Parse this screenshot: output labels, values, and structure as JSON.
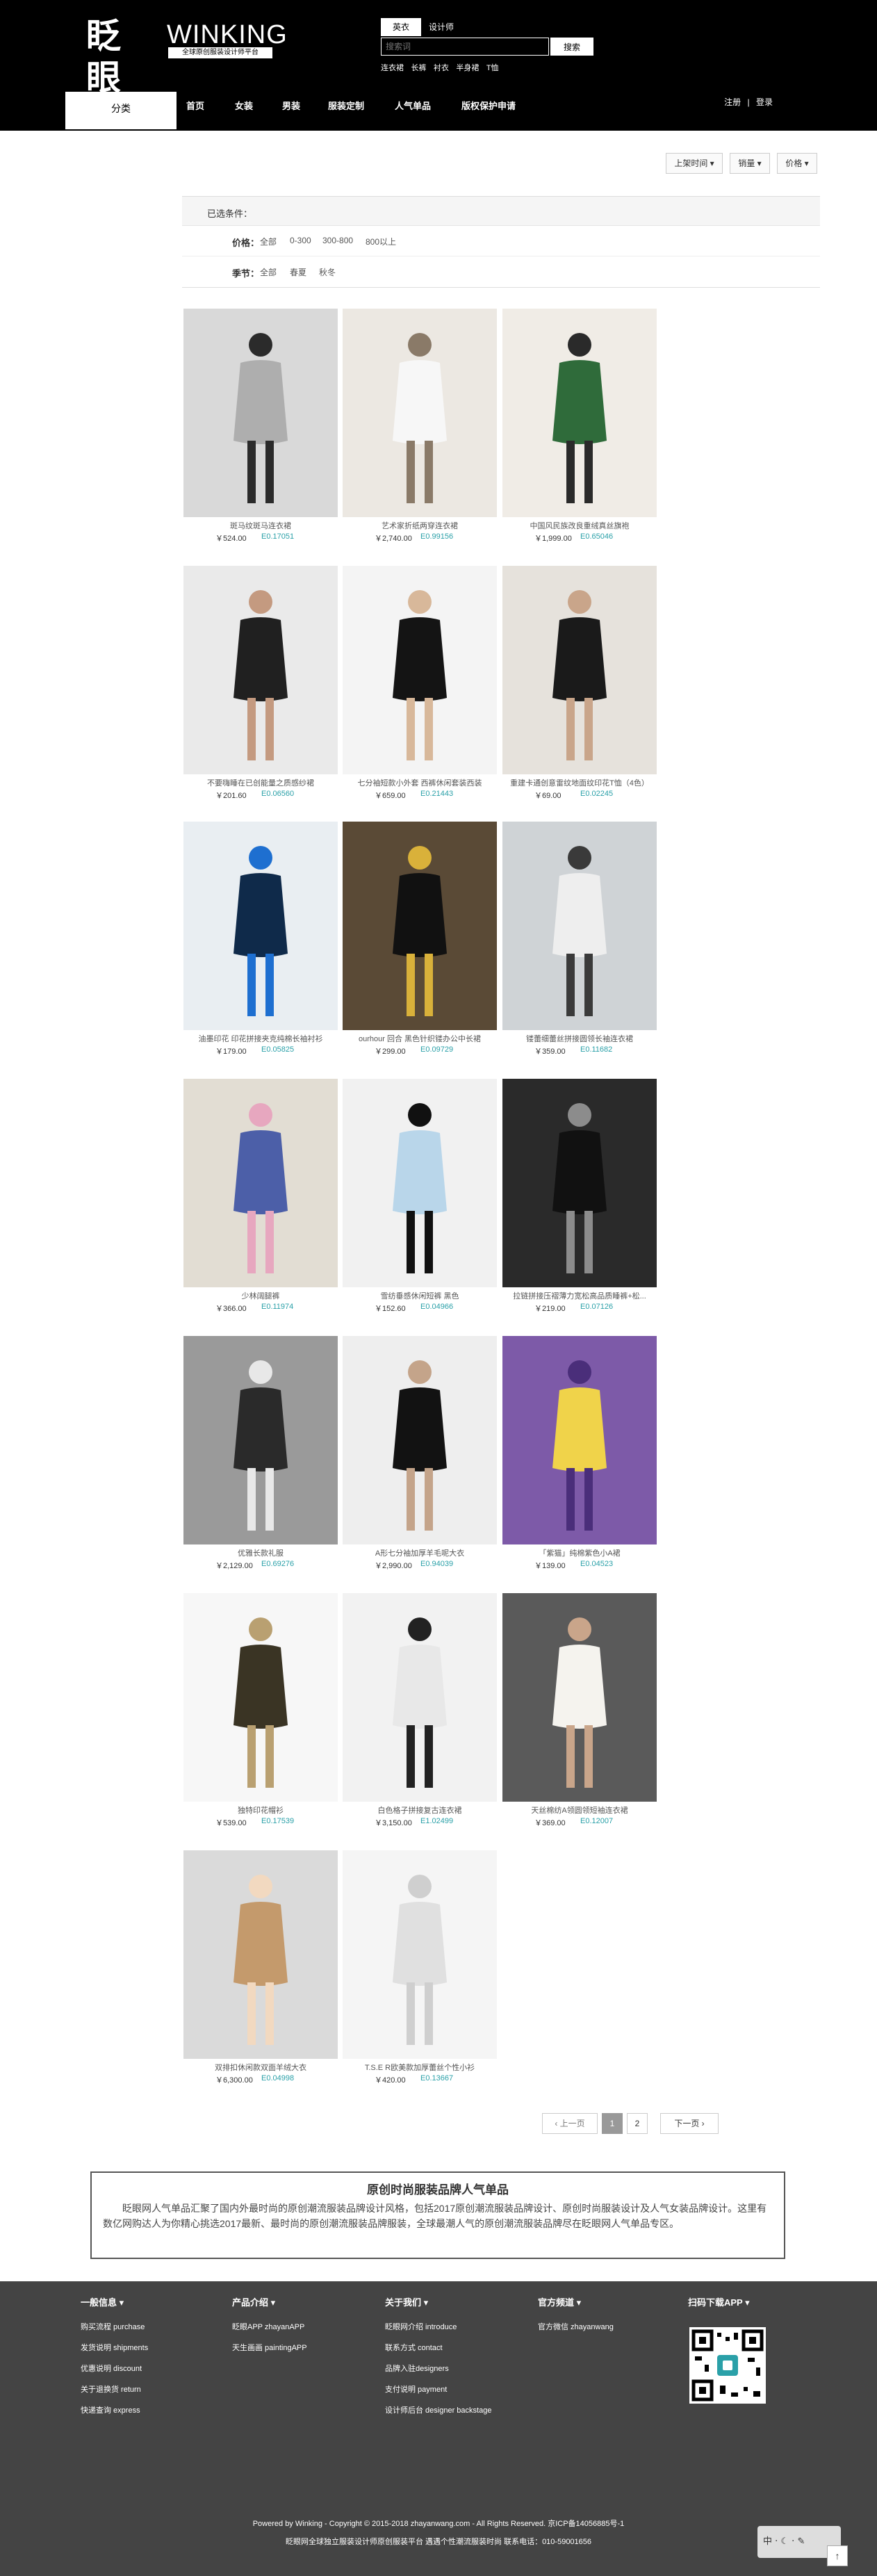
{
  "header": {
    "logo_cn": "眨眼",
    "logo_en": "WINKING",
    "logo_sub": "全球原创服装设计师平台",
    "search_tabs": [
      "英衣",
      "设计师"
    ],
    "search_placeholder": "搜索词",
    "search_button": "搜索",
    "hot_words": [
      "连衣裙",
      "长裤",
      "衬衣",
      "半身裙",
      "T恤"
    ],
    "nav_category": "分类",
    "nav_items": [
      "首页",
      "女装",
      "男装",
      "服装定制",
      "人气单品",
      "版权保护申请"
    ],
    "login": "注册",
    "divider": "|",
    "register": "登录"
  },
  "sort": [
    "上架时间 ▾",
    "销量 ▾",
    "价格 ▾"
  ],
  "filter": {
    "head": "已选条件：",
    "price_label": "价格：",
    "price_options": [
      "全部",
      "0-300",
      "300-800",
      "800以上"
    ],
    "season_label": "季节：",
    "season_options": [
      "全部",
      "春夏",
      "秋冬"
    ]
  },
  "products": [
    {
      "name": "斑马纹斑马连衣裙",
      "price": "￥524.00",
      "exch": "E0.17051"
    },
    {
      "name": "艺术家折纸两穿连衣裙",
      "price": "￥2,740.00",
      "exch": "E0.99156"
    },
    {
      "name": "中国风民族改良重绒真丝旗袍",
      "price": "￥1,999.00",
      "exch": "E0.65046"
    },
    {
      "name": "不要嗨睡在已创能量之质感纱裙",
      "price": "￥201.60",
      "exch": "E0.06560"
    },
    {
      "name": "七分袖短款小外套 西裤休闲套装西装",
      "price": "￥659.00",
      "exch": "E0.21443"
    },
    {
      "name": "重建卡通创意雷纹地面纹印花T恤（4色）",
      "price": "￥69.00",
      "exch": "E0.02245"
    },
    {
      "name": "油墨印花 印花拼接夹克纯棉长袖衬衫",
      "price": "￥179.00",
      "exch": "E0.05825"
    },
    {
      "name": "ourhour 回合 黑色针织镂办公中长裙",
      "price": "￥299.00",
      "exch": "E0.09729"
    },
    {
      "name": "镂蕾细蕾丝拼接圆领长袖连衣裙",
      "price": "￥359.00",
      "exch": "E0.11682"
    },
    {
      "name": "少林阔腿裤",
      "price": "￥366.00",
      "exch": "E0.11974"
    },
    {
      "name": "雪纺垂感休闲短裤 黑色",
      "price": "￥152.60",
      "exch": "E0.04966"
    },
    {
      "name": "拉链拼接压褶薄力宽松高品质睡裤+松...",
      "price": "￥219.00",
      "exch": "E0.07126"
    },
    {
      "name": "优雅长款礼服",
      "price": "￥2,129.00",
      "exch": "E0.69276"
    },
    {
      "name": "A形七分袖加厚羊毛呢大衣",
      "price": "￥2,990.00",
      "exch": "E0.94039"
    },
    {
      "name": "「紫猫」纯棉紫色小A裙",
      "price": "￥139.00",
      "exch": "E0.04523"
    },
    {
      "name": "独特印花帽衫",
      "price": "￥539.00",
      "exch": "E0.17539"
    },
    {
      "name": "白色格子拼接复古连衣裙",
      "price": "￥3,150.00",
      "exch": "E1.02499"
    },
    {
      "name": "天丝棉纺A领圆领短袖连衣裙",
      "price": "￥369.00",
      "exch": "E0.12007"
    },
    {
      "name": "双排扣休闲款双面羊绒大衣",
      "price": "￥6,300.00",
      "exch": "E0.04998"
    },
    {
      "name": "T.S.E R欧美款加厚蕾丝个性小衫",
      "price": "￥420.00",
      "exch": "E0.13667"
    }
  ],
  "pager": {
    "prev": "‹ 上一页",
    "p1": "1",
    "p2": "2",
    "next": "下一页 ›"
  },
  "intro": {
    "title": "原创时尚服装品牌人气单品",
    "text": "眨眼网人气单品汇聚了国内外最时尚的原创潮流服装品牌设计风格，包括2017原创潮流服装品牌设计、原创时尚服装设计及人气女装品牌设计。这里有数亿网购达人为你精心挑选2017最新、最时尚的原创潮流服装品牌服装，全球最潮人气的原创潮流服装品牌尽在眨眼网人气单品专区。"
  },
  "footer": {
    "cols": [
      {
        "title": "一般信息 ▾",
        "links": [
          "购买流程 purchase",
          "发货说明 shipments",
          "优惠说明 discount",
          "关于退换货 return",
          "快递查询 express"
        ]
      },
      {
        "title": "产品介绍 ▾",
        "links": [
          "眨眼APP zhayanAPP",
          "天生画画 paintingAPP"
        ]
      },
      {
        "title": "关于我们 ▾",
        "links": [
          "眨眼网介绍 introduce",
          "联系方式 contact",
          "品牌入驻designers",
          "支付说明 payment",
          "设计师后台 designer backstage"
        ]
      },
      {
        "title": "官方频道 ▾",
        "links": [
          "官方微信 zhayanwang"
        ]
      },
      {
        "title": "扫码下载APP ▾",
        "links": []
      }
    ],
    "copyright": "Powered by Winking - Copyright © 2015-2018 zhayanwang.com - All Rights Reserved.   京ICP备14056885号-1",
    "copyright2": "眨眼网全球独立服装设计师原创服装平台 遇遇个性潮流服装时尚       联系电话：010-59001656",
    "to_top": "↑"
  },
  "colors": {
    "header_bg": "#000000",
    "footer_bg": "#444444",
    "exch": "#2aa0a8"
  }
}
